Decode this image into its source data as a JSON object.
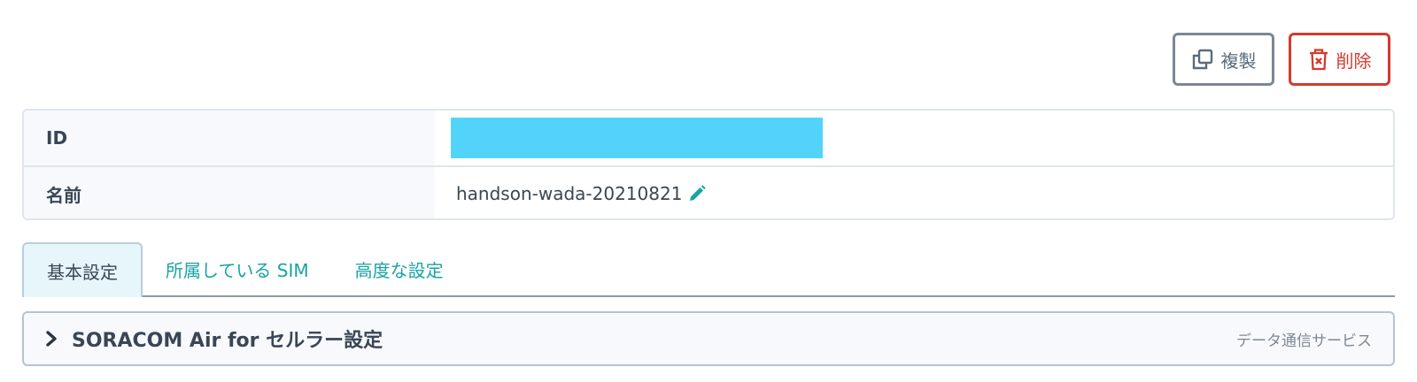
{
  "actions": {
    "duplicate_label": "複製",
    "delete_label": "削除"
  },
  "info": {
    "rows": [
      {
        "key": "ID",
        "value": ""
      },
      {
        "key": "名前",
        "value": "handson-wada-20210821"
      }
    ]
  },
  "tabs": [
    {
      "label": "基本設定",
      "active": true
    },
    {
      "label": "所属している SIM",
      "active": false
    },
    {
      "label": "高度な設定",
      "active": false
    }
  ],
  "section": {
    "title": "SORACOM Air for セルラー設定",
    "subtitle": "データ通信サービス"
  },
  "colors": {
    "accent": "#1aa3a3",
    "danger": "#d33a2c",
    "mask": "#52d4fa"
  },
  "icons": [
    "duplicate-icon",
    "trash-icon",
    "pencil-icon",
    "chevron-right-icon"
  ]
}
